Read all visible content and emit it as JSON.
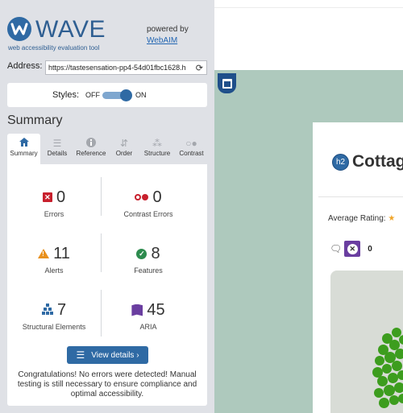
{
  "wave": {
    "logo_text": "WAVE",
    "logo_subtitle": "web accessibility evaluation tool",
    "powered_by": "powered by",
    "webaim_link": "WebAIM",
    "address_label": "Address:",
    "address_value": "https://tastesensation-pp4-54d01fbc1628.h",
    "styles_label": "Styles:",
    "styles_off": "OFF",
    "styles_on": "ON",
    "summary_title": "Summary",
    "tabs": [
      {
        "label": "Summary",
        "icon": "home-icon"
      },
      {
        "label": "Details",
        "icon": "list-icon"
      },
      {
        "label": "Reference",
        "icon": "info-icon"
      },
      {
        "label": "Order",
        "icon": "order-icon"
      },
      {
        "label": "Structure",
        "icon": "structure-icon"
      },
      {
        "label": "Contrast",
        "icon": "contrast-icon"
      }
    ],
    "stats": {
      "errors": {
        "count": "0",
        "label": "Errors"
      },
      "contrast_errors": {
        "count": "0",
        "label": "Contrast Errors"
      },
      "alerts": {
        "count": "11",
        "label": "Alerts"
      },
      "features": {
        "count": "8",
        "label": "Features"
      },
      "structural": {
        "count": "7",
        "label": "Structural Elements"
      },
      "aria": {
        "count": "45",
        "label": "ARIA"
      }
    },
    "view_details": "View details ›",
    "congrats": "Congratulations! No errors were detected! Manual testing is still necessary to ensure compliance and optimal accessibility."
  },
  "page": {
    "h2_badge": "h2",
    "card_title": "Cottag",
    "rating_label": "Average Rating:",
    "comment_count": "0"
  },
  "colors": {
    "wave_blue": "#2f6aa4",
    "error_red": "#c8202d",
    "alert_orange": "#e8901c",
    "feature_green": "#2d8b4e",
    "aria_purple": "#6a3ea0",
    "page_background": "#aec9bd"
  }
}
